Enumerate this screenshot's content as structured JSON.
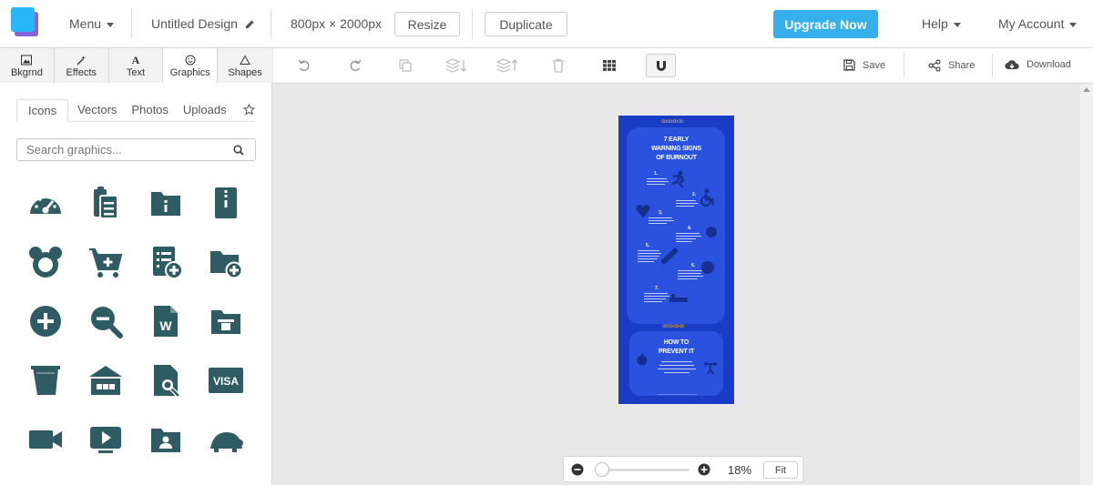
{
  "topbar": {
    "menu_label": "Menu",
    "doc_title": "Untitled Design",
    "doc_size": "800px × 2000px",
    "resize_label": "Resize",
    "duplicate_label": "Duplicate",
    "upgrade_label": "Upgrade Now",
    "help_label": "Help",
    "account_label": "My Account"
  },
  "left_tabs": [
    {
      "label": "Bkgrnd",
      "icon": "image-icon"
    },
    {
      "label": "Effects",
      "icon": "wand-icon"
    },
    {
      "label": "Text",
      "icon": "text-icon"
    },
    {
      "label": "Graphics",
      "icon": "smiley-icon"
    },
    {
      "label": "Shapes",
      "icon": "triangle-icon"
    }
  ],
  "sub_tabs": [
    "Icons",
    "Vectors",
    "Photos",
    "Uploads"
  ],
  "search": {
    "placeholder": "Search graphics..."
  },
  "graphics_icons": [
    "speedometer-icon",
    "clipboard-icon",
    "folder-info-icon",
    "zip-file-icon",
    "mouse-ears-icon",
    "add-to-cart-icon",
    "list-add-icon",
    "folder-add-icon",
    "plus-circle-icon",
    "zoom-out-icon",
    "word-file-icon",
    "folder-open-icon",
    "trash-bin-icon",
    "warehouse-icon",
    "file-search-icon",
    "visa-card-icon",
    "video-camera-icon",
    "video-play-icon",
    "folder-user-icon",
    "turtle-icon"
  ],
  "visa_text": "VISA",
  "word_text": "W",
  "toolbar": {
    "save_label": "Save",
    "share_label": "Share",
    "download_label": "Download"
  },
  "design": {
    "title": "7 EARLY WARNING SIGNS OF BURNOUT",
    "title_lines": [
      "7 EARLY",
      "WARNING SIGNS",
      "OF BURNOUT"
    ],
    "steps": [
      "1.",
      "2.",
      "3.",
      "4.",
      "5.",
      "6.",
      "7."
    ],
    "section2_lines": [
      "HOW TO",
      "PREVENT IT"
    ],
    "accent_color": "#e0b04c",
    "background_color": "#1a3bc4",
    "card_color": "#2b52df"
  },
  "zoom": {
    "percent": "18%",
    "fit_label": "Fit",
    "level": 0.18
  },
  "colors": {
    "accent": "#35b0ec",
    "icon": "#2f5b63"
  }
}
